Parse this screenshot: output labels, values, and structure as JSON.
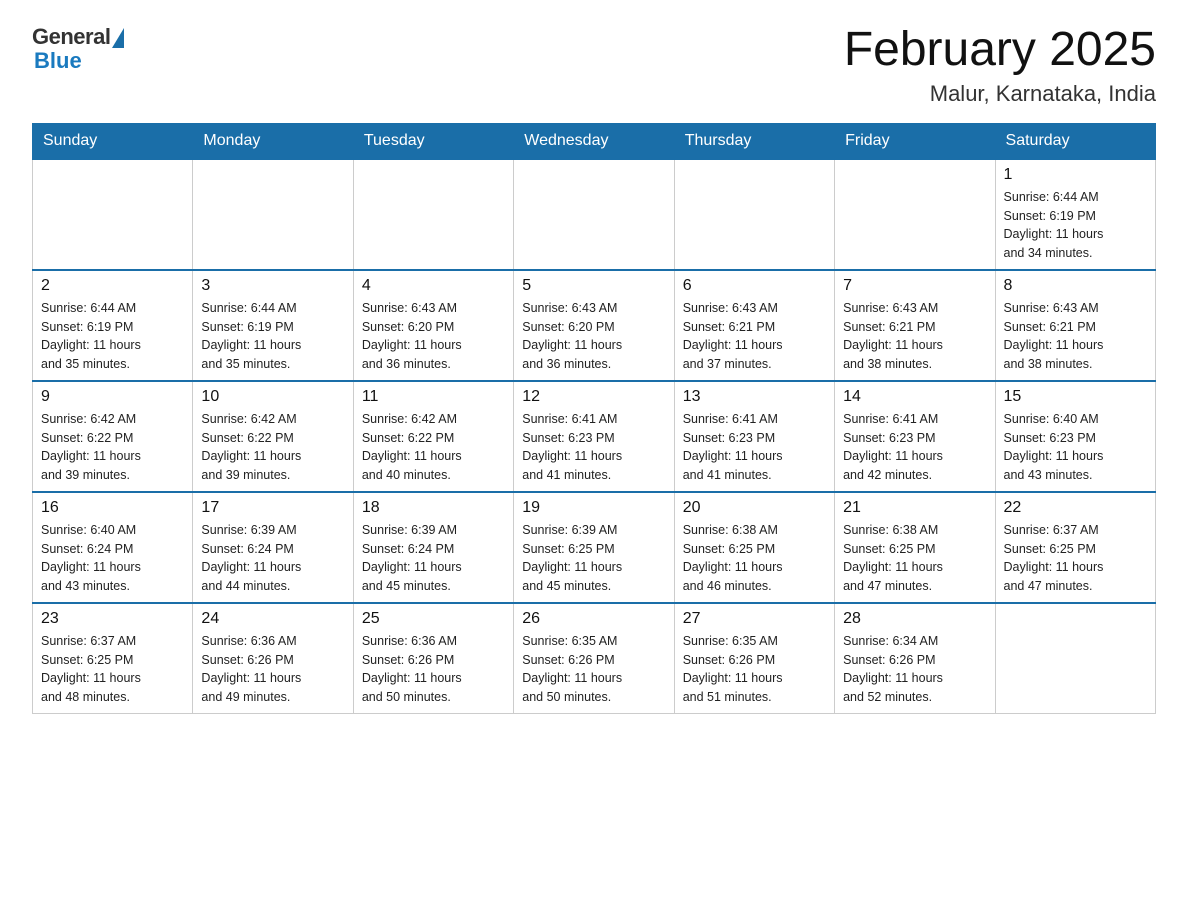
{
  "logo": {
    "general": "General",
    "blue": "Blue"
  },
  "title": "February 2025",
  "subtitle": "Malur, Karnataka, India",
  "weekdays": [
    "Sunday",
    "Monday",
    "Tuesday",
    "Wednesday",
    "Thursday",
    "Friday",
    "Saturday"
  ],
  "weeks": [
    [
      {
        "day": "",
        "info": ""
      },
      {
        "day": "",
        "info": ""
      },
      {
        "day": "",
        "info": ""
      },
      {
        "day": "",
        "info": ""
      },
      {
        "day": "",
        "info": ""
      },
      {
        "day": "",
        "info": ""
      },
      {
        "day": "1",
        "info": "Sunrise: 6:44 AM\nSunset: 6:19 PM\nDaylight: 11 hours\nand 34 minutes."
      }
    ],
    [
      {
        "day": "2",
        "info": "Sunrise: 6:44 AM\nSunset: 6:19 PM\nDaylight: 11 hours\nand 35 minutes."
      },
      {
        "day": "3",
        "info": "Sunrise: 6:44 AM\nSunset: 6:19 PM\nDaylight: 11 hours\nand 35 minutes."
      },
      {
        "day": "4",
        "info": "Sunrise: 6:43 AM\nSunset: 6:20 PM\nDaylight: 11 hours\nand 36 minutes."
      },
      {
        "day": "5",
        "info": "Sunrise: 6:43 AM\nSunset: 6:20 PM\nDaylight: 11 hours\nand 36 minutes."
      },
      {
        "day": "6",
        "info": "Sunrise: 6:43 AM\nSunset: 6:21 PM\nDaylight: 11 hours\nand 37 minutes."
      },
      {
        "day": "7",
        "info": "Sunrise: 6:43 AM\nSunset: 6:21 PM\nDaylight: 11 hours\nand 38 minutes."
      },
      {
        "day": "8",
        "info": "Sunrise: 6:43 AM\nSunset: 6:21 PM\nDaylight: 11 hours\nand 38 minutes."
      }
    ],
    [
      {
        "day": "9",
        "info": "Sunrise: 6:42 AM\nSunset: 6:22 PM\nDaylight: 11 hours\nand 39 minutes."
      },
      {
        "day": "10",
        "info": "Sunrise: 6:42 AM\nSunset: 6:22 PM\nDaylight: 11 hours\nand 39 minutes."
      },
      {
        "day": "11",
        "info": "Sunrise: 6:42 AM\nSunset: 6:22 PM\nDaylight: 11 hours\nand 40 minutes."
      },
      {
        "day": "12",
        "info": "Sunrise: 6:41 AM\nSunset: 6:23 PM\nDaylight: 11 hours\nand 41 minutes."
      },
      {
        "day": "13",
        "info": "Sunrise: 6:41 AM\nSunset: 6:23 PM\nDaylight: 11 hours\nand 41 minutes."
      },
      {
        "day": "14",
        "info": "Sunrise: 6:41 AM\nSunset: 6:23 PM\nDaylight: 11 hours\nand 42 minutes."
      },
      {
        "day": "15",
        "info": "Sunrise: 6:40 AM\nSunset: 6:23 PM\nDaylight: 11 hours\nand 43 minutes."
      }
    ],
    [
      {
        "day": "16",
        "info": "Sunrise: 6:40 AM\nSunset: 6:24 PM\nDaylight: 11 hours\nand 43 minutes."
      },
      {
        "day": "17",
        "info": "Sunrise: 6:39 AM\nSunset: 6:24 PM\nDaylight: 11 hours\nand 44 minutes."
      },
      {
        "day": "18",
        "info": "Sunrise: 6:39 AM\nSunset: 6:24 PM\nDaylight: 11 hours\nand 45 minutes."
      },
      {
        "day": "19",
        "info": "Sunrise: 6:39 AM\nSunset: 6:25 PM\nDaylight: 11 hours\nand 45 minutes."
      },
      {
        "day": "20",
        "info": "Sunrise: 6:38 AM\nSunset: 6:25 PM\nDaylight: 11 hours\nand 46 minutes."
      },
      {
        "day": "21",
        "info": "Sunrise: 6:38 AM\nSunset: 6:25 PM\nDaylight: 11 hours\nand 47 minutes."
      },
      {
        "day": "22",
        "info": "Sunrise: 6:37 AM\nSunset: 6:25 PM\nDaylight: 11 hours\nand 47 minutes."
      }
    ],
    [
      {
        "day": "23",
        "info": "Sunrise: 6:37 AM\nSunset: 6:25 PM\nDaylight: 11 hours\nand 48 minutes."
      },
      {
        "day": "24",
        "info": "Sunrise: 6:36 AM\nSunset: 6:26 PM\nDaylight: 11 hours\nand 49 minutes."
      },
      {
        "day": "25",
        "info": "Sunrise: 6:36 AM\nSunset: 6:26 PM\nDaylight: 11 hours\nand 50 minutes."
      },
      {
        "day": "26",
        "info": "Sunrise: 6:35 AM\nSunset: 6:26 PM\nDaylight: 11 hours\nand 50 minutes."
      },
      {
        "day": "27",
        "info": "Sunrise: 6:35 AM\nSunset: 6:26 PM\nDaylight: 11 hours\nand 51 minutes."
      },
      {
        "day": "28",
        "info": "Sunrise: 6:34 AM\nSunset: 6:26 PM\nDaylight: 11 hours\nand 52 minutes."
      },
      {
        "day": "",
        "info": ""
      }
    ]
  ]
}
